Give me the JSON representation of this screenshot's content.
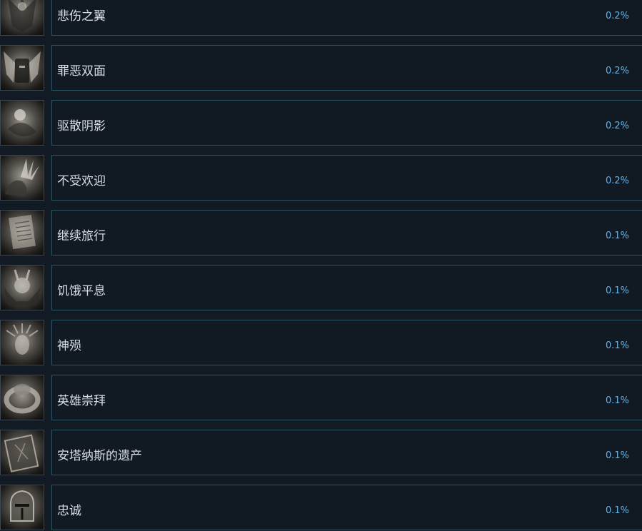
{
  "achievements": [
    {
      "title": "悲伤之翼",
      "percent": "0.2%",
      "icon": "winged-statue-icon"
    },
    {
      "title": "罪恶双面",
      "percent": "0.2%",
      "icon": "winged-helmet-icon"
    },
    {
      "title": "驱散阴影",
      "percent": "0.2%",
      "icon": "orb-icon"
    },
    {
      "title": "不受欢迎",
      "percent": "0.2%",
      "icon": "spiked-creature-icon"
    },
    {
      "title": "继续旅行",
      "percent": "0.1%",
      "icon": "scroll-icon"
    },
    {
      "title": "饥饿平息",
      "percent": "0.1%",
      "icon": "horned-demon-icon"
    },
    {
      "title": "神殒",
      "percent": "0.1%",
      "icon": "crowned-face-icon"
    },
    {
      "title": "英雄崇拜",
      "percent": "0.1%",
      "icon": "ring-icon"
    },
    {
      "title": "安塔纳斯的遗产",
      "percent": "0.1%",
      "icon": "tome-icon"
    },
    {
      "title": "忠诚",
      "percent": "0.1%",
      "icon": "knight-helmet-icon"
    }
  ]
}
